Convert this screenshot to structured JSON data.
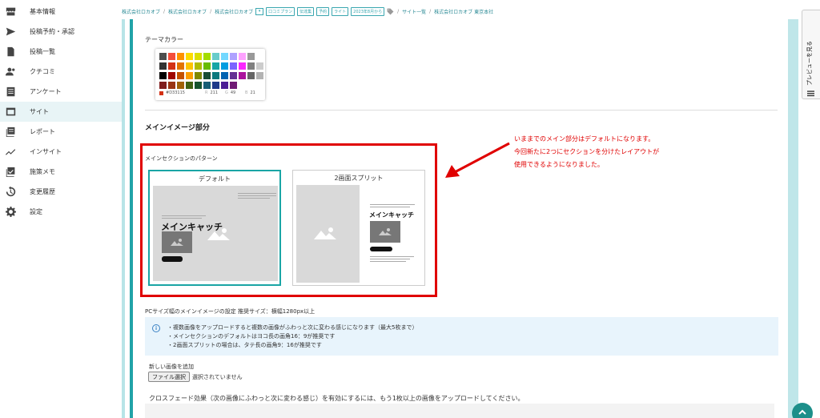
{
  "sidebar": {
    "items": [
      {
        "label": "基本情報",
        "icon": "store-icon"
      },
      {
        "label": "投稿予約・承認",
        "icon": "send-icon"
      },
      {
        "label": "投稿一覧",
        "icon": "document-icon"
      },
      {
        "label": "クチコミ",
        "icon": "users-icon"
      },
      {
        "label": "アンケート",
        "icon": "list-icon"
      },
      {
        "label": "サイト",
        "icon": "browser-icon",
        "active": true
      },
      {
        "label": "レポート",
        "icon": "report-icon"
      },
      {
        "label": "インサイト",
        "icon": "trend-icon"
      },
      {
        "label": "施策メモ",
        "icon": "checklist-icon"
      },
      {
        "label": "変更履歴",
        "icon": "history-icon"
      },
      {
        "label": "設定",
        "icon": "gear-icon"
      }
    ]
  },
  "breadcrumb": {
    "item1": "株式会社ロカオブ",
    "item2": "株式会社ロカオブ",
    "item3": "株式会社ロカオブ",
    "tags": [
      "口コミプラン",
      "伝達集",
      "予約",
      "ライト",
      "2023年8月から"
    ],
    "item4": "サイト一覧",
    "item5": "株式会社ロカオブ 東京本社",
    "sep": "/"
  },
  "theme": {
    "label": "テーマカラー",
    "hex": "#D33115",
    "r_label": "R",
    "r": "211",
    "g_label": "G",
    "g": "49",
    "b_label": "B",
    "b": "21"
  },
  "main_image": {
    "section_title": "メインイメージ部分",
    "pattern_label": "メインセクションのパターン",
    "default_card": {
      "title": "デフォルト",
      "catch": "メインキャッチ"
    },
    "split_card": {
      "title": "2画面スプリット",
      "catch": "メインキャッチ"
    }
  },
  "annotation": {
    "line1": "いままでのメイン部分はデフォルトになります。",
    "line2": "今回新たに2つにセクションを分けたレイアウトが",
    "line3": "使用できるようになりました。"
  },
  "pc_image": {
    "label": "PCサイズ幅のメインイメージの設定  推奨サイズ：横幅1280px以上",
    "info1": "・複数画像をアップロードすると複数の画像がふわっと次に変わる感じになります（最大5枚まで）",
    "info2": "・メインセクションのデフォルトはヨコ長の画角16：9が推奨です",
    "info3": "・2画面スプリットの場合は、タテ長の画角9：16が推奨です",
    "new_image_label": "新しい画像を追加",
    "file_button": "ファイル選択",
    "file_status": "選択されていません",
    "crossfade_text": "クロスフェード効果（次の画像にふわっと次に変わる感じ）を有効にするには、もう1枚以上の画像をアップロードしてください。"
  },
  "preview_tab": {
    "label": "プレビューを見る"
  },
  "colors": {
    "accent": "#21a3a8",
    "annotation": "#e00000",
    "palette": [
      [
        "#4d4d4d",
        "#f44e3b",
        "#fe9200",
        "#fcdc00",
        "#dbdf00",
        "#a4dd00",
        "#68ccca",
        "#73d8ff",
        "#aea1ff",
        "#fda1ff",
        "#999999",
        "#ffffff"
      ],
      [
        "#333333",
        "#d33115",
        "#e27300",
        "#fcc400",
        "#b0bc00",
        "#68bc00",
        "#16a5a5",
        "#009ce0",
        "#7b64ff",
        "#fa28ff",
        "#808080",
        "#cccccc"
      ],
      [
        "#000000",
        "#9f0500",
        "#c45100",
        "#fb9e00",
        "#808900",
        "#194d33",
        "#0c797d",
        "#0062b1",
        "#653294",
        "#ab149e",
        "#666666",
        "#b3b3b3"
      ]
    ]
  }
}
